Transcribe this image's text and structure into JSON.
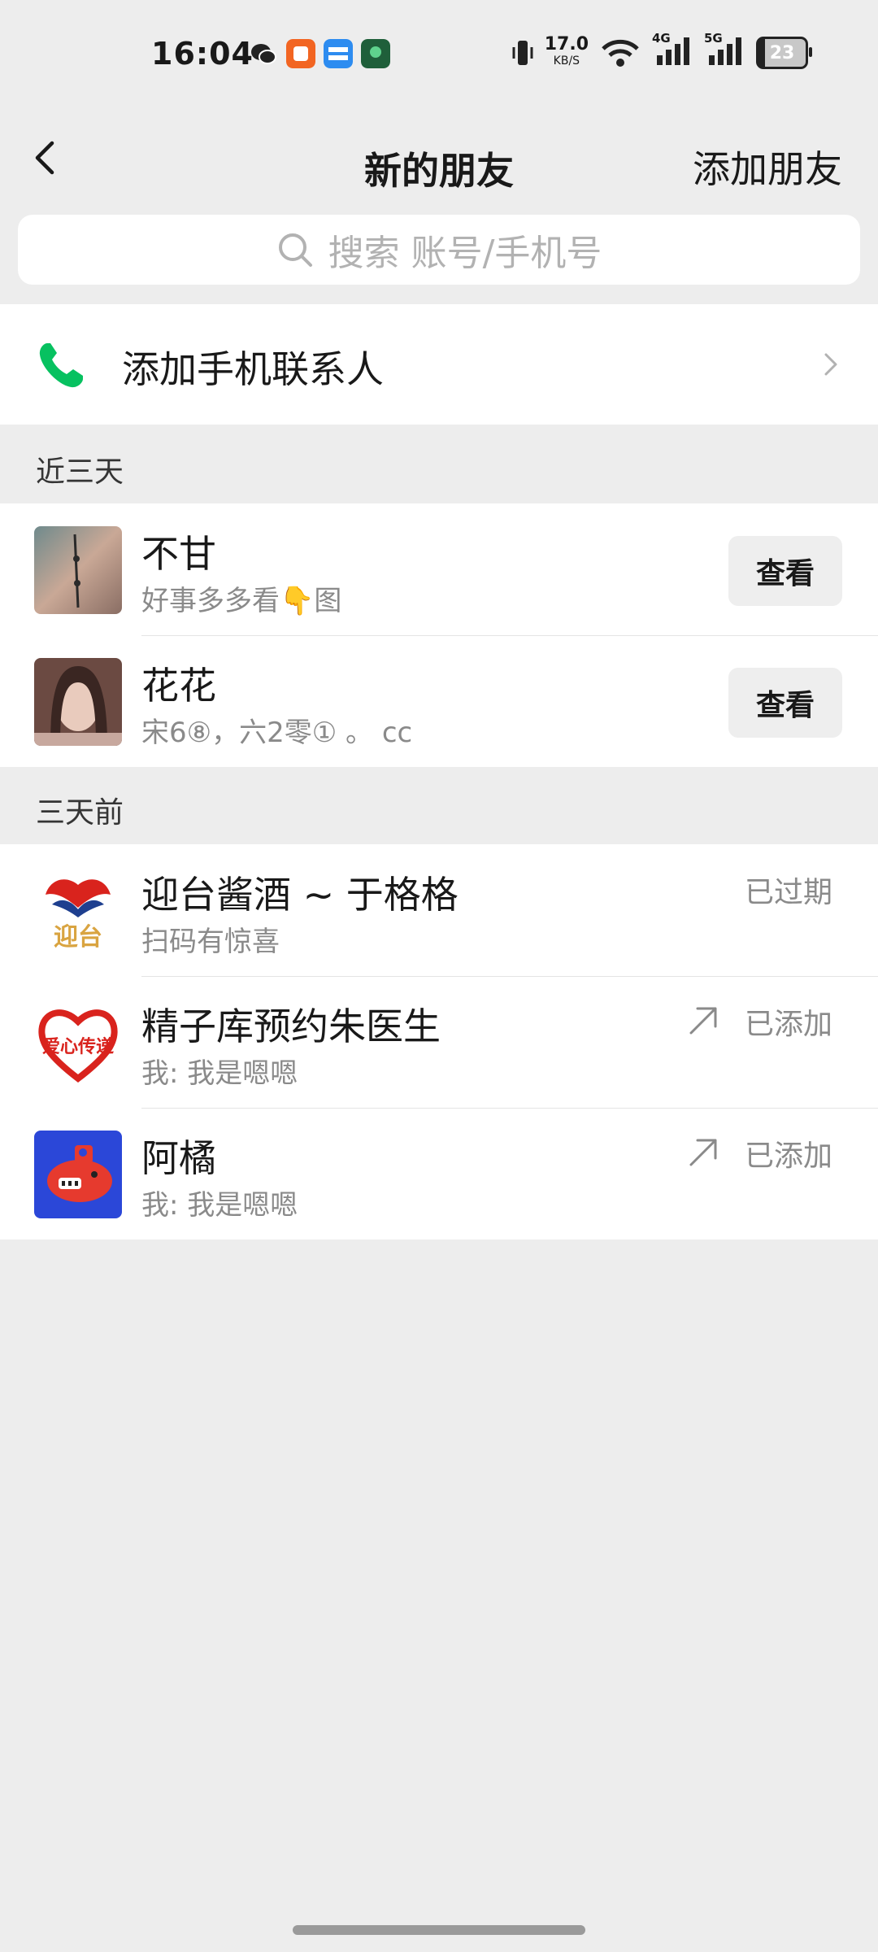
{
  "status_bar": {
    "time": "16:04",
    "speed_value": "17.0",
    "speed_unit": "KB/S",
    "net_4g": "4G",
    "net_5g": "5G",
    "battery": "23"
  },
  "header": {
    "title": "新的朋友",
    "add_friend": "添加朋友"
  },
  "search": {
    "placeholder": "搜索 账号/手机号"
  },
  "phone_contacts": {
    "label": "添加手机联系人"
  },
  "sections": [
    {
      "title": "近三天",
      "items": [
        {
          "name": "不甘",
          "message": "好事多多看👇图",
          "action": "查看"
        },
        {
          "name": "花花",
          "message": "宋6⑧，六2零①  。 cc",
          "action": "查看"
        }
      ]
    },
    {
      "title": "三天前",
      "items": [
        {
          "name": "迎台酱酒 ~ 于格格",
          "message": "扫码有惊喜",
          "status": "已过期",
          "avatar_text": "迎台"
        },
        {
          "name": "精子库预约朱医生",
          "message": "我: 我是嗯嗯",
          "status": "已添加",
          "avatar_text": "爱心传递"
        },
        {
          "name": "阿橘",
          "message": "我: 我是嗯嗯",
          "status": "已添加"
        }
      ]
    }
  ],
  "colors": {
    "background": "#ededed",
    "phone_green": "#07c160",
    "secondary_text": "#8a8a8a"
  }
}
